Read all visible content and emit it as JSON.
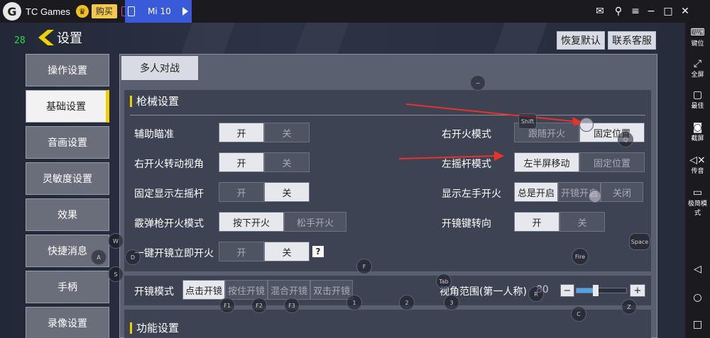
{
  "topbar": {
    "app_name": "TC Games",
    "buy_label": "购买",
    "tab_label": "Mi 10"
  },
  "game": {
    "fps": "28",
    "title": "设置",
    "restore_btn": "恢复默认",
    "support_btn": "联系客服"
  },
  "sidebar": {
    "items": [
      "操作设置",
      "基础设置",
      "音画设置",
      "灵敏度设置",
      "效果",
      "快捷消息",
      "手柄",
      "录像设置"
    ]
  },
  "panel": {
    "tab": "多人对战",
    "section1_title": "枪械设置",
    "section2_title": "功能设置"
  },
  "settings": {
    "aim_assist": {
      "label": "辅助瞄准",
      "on": "开",
      "off": "关"
    },
    "right_fire_view": {
      "label": "右开火转动视角",
      "on": "开",
      "off": "关"
    },
    "show_left_stick": {
      "label": "固定显示左摇杆",
      "on": "开",
      "off": "关"
    },
    "shotgun_fire": {
      "label": "霰弹枪开火模式",
      "a": "按下开火",
      "b": "松手开火"
    },
    "scope_fire": {
      "label": "一键开镜立即开火",
      "on": "开",
      "off": "关",
      "help": "?"
    },
    "right_fire_mode": {
      "label": "右开火模式",
      "a": "跟随开火",
      "b": "固定位置"
    },
    "left_stick_mode": {
      "label": "左摇杆模式",
      "a": "左半屏移动",
      "b": "固定位置"
    },
    "left_fire_btn": {
      "label": "显示左手开火",
      "a": "总是开启",
      "b": "开镜开启",
      "c": "关闭"
    },
    "scope_turn": {
      "label": "开镜键转向",
      "on": "开",
      "off": "关"
    },
    "scope_mode": {
      "label": "开镜模式",
      "a": "点击开镜",
      "b": "按住开镜",
      "c": "混合开镜",
      "d": "双击开镜"
    },
    "fov": {
      "label": "视角范围(第一人称)",
      "value": "80",
      "minus": "−",
      "plus": "+"
    }
  },
  "keys": [
    "W",
    "A",
    "S",
    "D",
    "F",
    "Shift",
    "Q",
    "Fire",
    "Space",
    "Tab",
    "R",
    "1",
    "2",
    "3",
    "F1",
    "F2",
    "F3",
    "C",
    "Z"
  ],
  "right_sidebar": {
    "items": [
      "键位",
      "全屏",
      "最佳",
      "截屏",
      "传音",
      "极简模式"
    ]
  }
}
